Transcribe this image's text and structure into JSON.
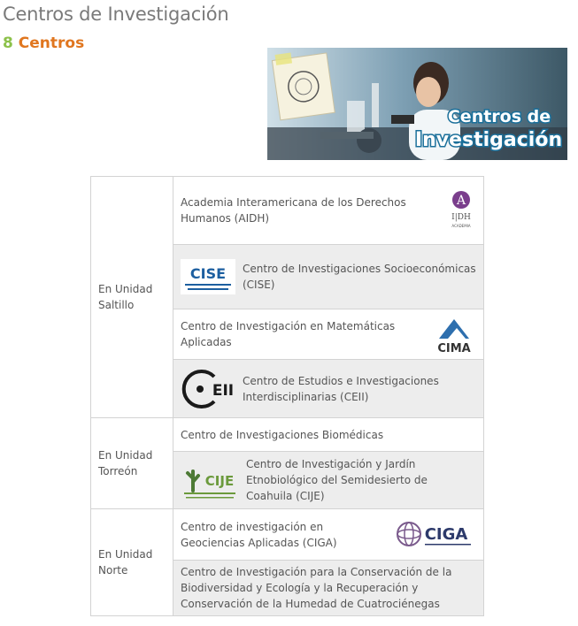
{
  "header": {
    "title": "Centros de Investigación",
    "count_number": "8",
    "count_label": "Centros"
  },
  "banner": {
    "text_line1": "Centros de",
    "text_line2": "Investigación"
  },
  "units": [
    {
      "label": "En Unidad Saltillo"
    },
    {
      "label": "En Unidad Torreón"
    },
    {
      "label": "En Unidad Norte"
    }
  ],
  "centers": [
    {
      "name": "Academia Interamericana de los Derechos Humanos (AIDH)",
      "logo": "aidh-logo",
      "logo_text": "I|DH",
      "logo_sub": "ACADEMIA"
    },
    {
      "name": "Centro de Investigaciones Socioeconómicas (CISE)",
      "logo": "cise-logo",
      "logo_text": "CISE"
    },
    {
      "name": "Centro de Investigación en Matemáticas Aplicadas",
      "logo": "cima-logo",
      "logo_text": "CIMA"
    },
    {
      "name": "Centro de Estudios e Investigaciones Interdisciplinarias (CEII)",
      "logo": "ceii-logo",
      "logo_text": "EII"
    },
    {
      "name": "Centro de Investigaciones Biomédicas"
    },
    {
      "name": "Centro de Investigación y Jardín Etnobiológico del Semidesierto de Coahuila (CIJE)",
      "logo": "cije-logo",
      "logo_text": "CIJE"
    },
    {
      "name": "Centro de investigación en Geociencias Aplicadas (CIGA)",
      "logo": "ciga-logo",
      "logo_text": "CIGA"
    },
    {
      "name": "Centro de Investigación para la Conservación de la Biodiversidad y Ecología y la Recuperación y Conservación de la Humedad de Cuatrociénegas"
    }
  ],
  "colors": {
    "title": "#7a7a7a",
    "count_number": "#8cc14a",
    "count_label": "#e0761f",
    "row_shade": "#ededed",
    "border": "#d3d3d3"
  }
}
